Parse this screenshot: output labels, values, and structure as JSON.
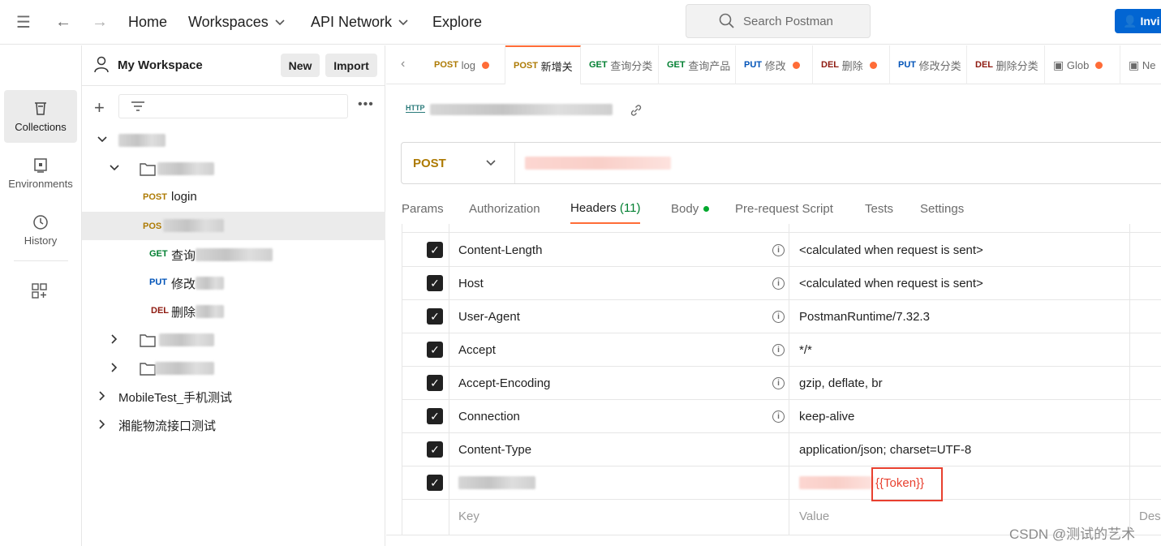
{
  "topbar": {
    "menu_icon": "hamburger-icon",
    "back_icon": "arrow-left-icon",
    "forward_icon": "arrow-right-icon",
    "nav": [
      "Home",
      "Workspaces",
      "API Network",
      "Explore"
    ],
    "search_placeholder": "Search Postman",
    "invite_label": "Invi"
  },
  "rail": {
    "items": [
      {
        "label": "Collections",
        "icon": "trash-can-icon"
      },
      {
        "label": "Environments",
        "icon": "environment-icon"
      },
      {
        "label": "History",
        "icon": "history-icon"
      }
    ]
  },
  "sidebar": {
    "workspace_name": "My Workspace",
    "new_label": "New",
    "import_label": "Import",
    "tree": {
      "request_1": {
        "method": "POST",
        "name": "login"
      },
      "request_2": {
        "method": "POS"
      },
      "request_3": {
        "method": "GET",
        "name": "查询"
      },
      "request_4": {
        "method": "PUT",
        "name": "修改"
      },
      "request_5": {
        "method": "DEL",
        "name": "删除"
      },
      "collection_1": "MobileTest_手机测试",
      "collection_2": "湘能物流接口测试"
    }
  },
  "tabs": [
    {
      "method": "POST",
      "name": "log",
      "dot": true
    },
    {
      "method": "POST",
      "name": "新增关",
      "dot": false,
      "active": true
    },
    {
      "method": "GET",
      "name": "查询分类",
      "dot": false
    },
    {
      "method": "GET",
      "name": "查询产品",
      "dot": false
    },
    {
      "method": "PUT",
      "name": "修改",
      "dot": true
    },
    {
      "method": "DEL",
      "name": "删除",
      "dot": true
    },
    {
      "method": "PUT",
      "name": "修改分类",
      "dot": false
    },
    {
      "method": "DEL",
      "name": "删除分类",
      "dot": false
    },
    {
      "method": "",
      "name": "Glob",
      "dot": true
    },
    {
      "method": "",
      "name": "Ne",
      "dot": false
    }
  ],
  "request": {
    "http_badge": "HTTP",
    "method": "POST",
    "tabs": {
      "params": "Params",
      "authorization": "Authorization",
      "headers": "Headers",
      "headers_count": "(11)",
      "body": "Body",
      "prerequest": "Pre-request Script",
      "tests": "Tests",
      "settings": "Settings"
    }
  },
  "headers_table": {
    "rows": [
      {
        "key": "Content-Length",
        "value": "<calculated when request is sent>"
      },
      {
        "key": "Host",
        "value": "<calculated when request is sent>"
      },
      {
        "key": "User-Agent",
        "value": "PostmanRuntime/7.32.3"
      },
      {
        "key": "Accept",
        "value": "*/*"
      },
      {
        "key": "Accept-Encoding",
        "value": "gzip, deflate, br"
      },
      {
        "key": "Connection",
        "value": "keep-alive"
      },
      {
        "key": "Content-Type",
        "value": "application/json; charset=UTF-8"
      }
    ],
    "token_value": "{{Token}}",
    "key_placeholder": "Key",
    "value_placeholder": "Value",
    "desc_placeholder": "Des"
  },
  "watermark": "CSDN @测试的艺术",
  "colors": {
    "accent": "#ff6c37",
    "post": "#ad7a03",
    "get": "#007f31",
    "put": "#0053b8",
    "del": "#8e1a10",
    "invite": "#0265d2",
    "highlight_box": "#e8402f"
  }
}
